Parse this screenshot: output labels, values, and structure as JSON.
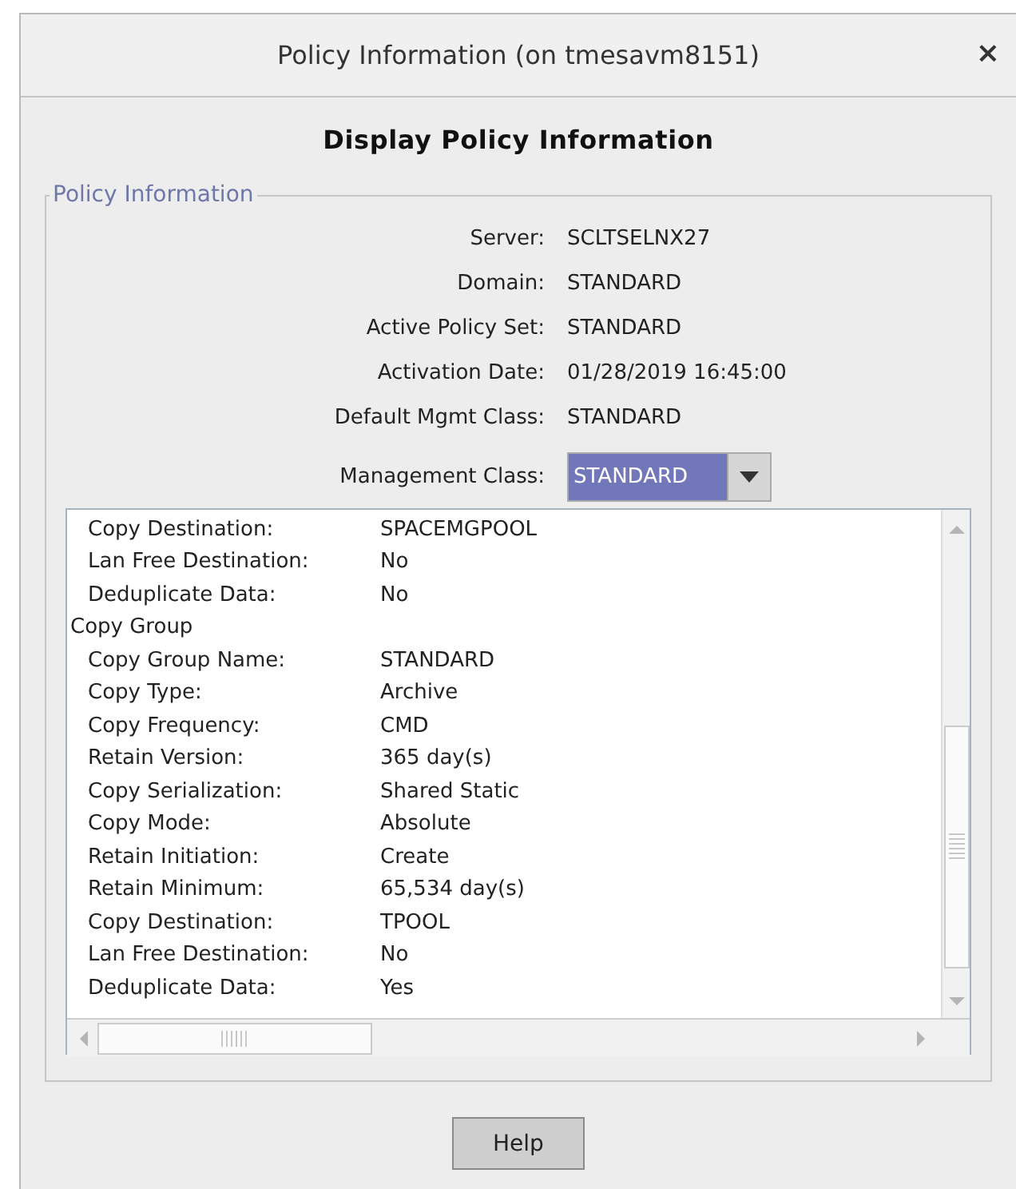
{
  "window": {
    "title": "Policy Information (on tmesavm8151)",
    "close": "×"
  },
  "heading": "Display Policy Information",
  "group": {
    "title": "Policy Information",
    "fields": [
      {
        "label": "Server:",
        "value": "SCLTSELNX27"
      },
      {
        "label": "Domain:",
        "value": "STANDARD"
      },
      {
        "label": "Active Policy Set:",
        "value": "STANDARD"
      },
      {
        "label": "Activation Date:",
        "value": "01/28/2019 16:45:00"
      },
      {
        "label": "Default Mgmt Class:",
        "value": "STANDARD"
      }
    ],
    "management_class": {
      "label": "Management Class:",
      "value": "STANDARD"
    },
    "details": [
      {
        "kind": "field",
        "label": "Copy Destination:",
        "value": "SPACEMGPOOL"
      },
      {
        "kind": "field",
        "label": "Lan Free Destination:",
        "value": "No"
      },
      {
        "kind": "field",
        "label": "Deduplicate Data:",
        "value": "No"
      },
      {
        "kind": "header",
        "label": "Copy Group"
      },
      {
        "kind": "field",
        "label": "Copy Group Name:",
        "value": "STANDARD"
      },
      {
        "kind": "field",
        "label": "Copy Type:",
        "value": "Archive"
      },
      {
        "kind": "field",
        "label": "Copy Frequency:",
        "value": "CMD"
      },
      {
        "kind": "field",
        "label": "Retain Version:",
        "value": "365 day(s)"
      },
      {
        "kind": "field",
        "label": "Copy Serialization:",
        "value": "Shared Static"
      },
      {
        "kind": "field",
        "label": "Copy Mode:",
        "value": "Absolute"
      },
      {
        "kind": "field",
        "label": "Retain Initiation:",
        "value": "Create"
      },
      {
        "kind": "field",
        "label": "Retain Minimum:",
        "value": "65,534 day(s)"
      },
      {
        "kind": "field",
        "label": "Copy Destination:",
        "value": "TPOOL"
      },
      {
        "kind": "field",
        "label": "Lan Free Destination:",
        "value": "No"
      },
      {
        "kind": "field",
        "label": "Deduplicate Data:",
        "value": "Yes"
      }
    ]
  },
  "buttons": [
    {
      "label": "Help"
    }
  ]
}
